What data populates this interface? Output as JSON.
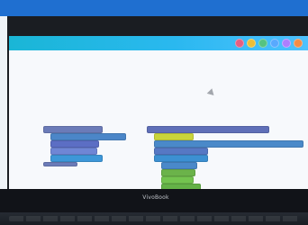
{
  "laptop": {
    "brand_label": "VivoBook"
  },
  "ui": {
    "toolbar_colors": [
      "#f05a7b",
      "#f6bf2d",
      "#57c47b",
      "#5aa8ff",
      "#b37cff",
      "#ff8a3d"
    ]
  }
}
